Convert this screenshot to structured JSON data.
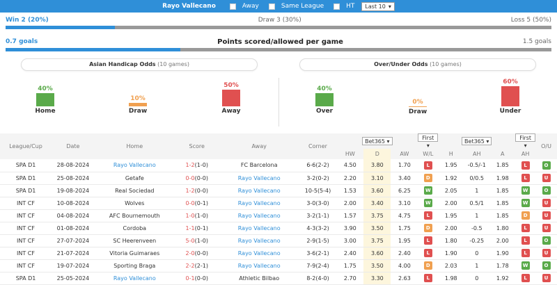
{
  "filter": {
    "team": "Rayo Vallecano",
    "away_label": "Away",
    "same_league_label": "Same League",
    "ht_label": "HT",
    "last_select": "Last 10"
  },
  "record": {
    "win": "Win 2 (20%)",
    "draw": "Draw 3 (30%)",
    "loss": "Loss 5 (50%)",
    "win_fraction": 0.2
  },
  "goals": {
    "scored": "0.7 goals",
    "title": "Points scored/allowed per game",
    "allowed": "1.5 goals",
    "scored_fraction": 0.32
  },
  "asian": {
    "title": "Asian Handicap Odds",
    "sub": "(10 games)",
    "cols": [
      {
        "label": "Home",
        "pct": "40%",
        "value": 40,
        "color": "#5aaa4a"
      },
      {
        "label": "Draw",
        "pct": "10%",
        "value": 10,
        "color": "#f0a050"
      },
      {
        "label": "Away",
        "pct": "50%",
        "value": 50,
        "color": "#e05050"
      }
    ]
  },
  "overunder": {
    "title": "Over/Under Odds",
    "sub": "(10 games)",
    "cols": [
      {
        "label": "Over",
        "pct": "40%",
        "value": 40,
        "color": "#5aaa4a"
      },
      {
        "label": "Draw",
        "pct": "0%",
        "value": 0,
        "color": "#f0a050"
      },
      {
        "label": "Under",
        "pct": "60%",
        "value": 60,
        "color": "#e05050"
      }
    ]
  },
  "table": {
    "headers": [
      "League/Cup",
      "Date",
      "Home",
      "Score",
      "Away",
      "Corner"
    ],
    "ou_header": "O/U",
    "bookmaker1": "Bet365",
    "bookmaker2": "Bet365",
    "first1": "First",
    "first2": "First",
    "sub_headers": [
      "HW",
      "D",
      "AW",
      "W/L",
      "H",
      "AH",
      "A",
      "AH"
    ],
    "rows": [
      {
        "league": "SPA D1",
        "date": "28-08-2024",
        "home": "Rayo Vallecano",
        "home_hl": true,
        "score": "1-2(1-0)",
        "away": "FC Barcelona",
        "away_hl": false,
        "corner": "6-6(2-2)",
        "hw": "4.50",
        "d": "3.80",
        "aw": "1.70",
        "wl": "L",
        "h": "1.95",
        "ah": "-0.5/-1",
        "a": "1.85",
        "ah2": "L",
        "ou": "O"
      },
      {
        "league": "SPA D1",
        "date": "25-08-2024",
        "home": "Getafe",
        "home_hl": false,
        "score": "0-0(0-0)",
        "away": "Rayo Vallecano",
        "away_hl": true,
        "corner": "3-2(0-2)",
        "hw": "2.20",
        "d": "3.10",
        "aw": "3.40",
        "wl": "D",
        "h": "1.92",
        "ah": "0/0.5",
        "a": "1.98",
        "ah2": "L",
        "ou": "U"
      },
      {
        "league": "SPA D1",
        "date": "19-08-2024",
        "home": "Real Sociedad",
        "home_hl": false,
        "score": "1-2(0-0)",
        "away": "Rayo Vallecano",
        "away_hl": true,
        "corner": "10-5(5-4)",
        "hw": "1.53",
        "d": "3.60",
        "aw": "6.25",
        "wl": "W",
        "h": "2.05",
        "ah": "1",
        "a": "1.85",
        "ah2": "W",
        "ou": "O"
      },
      {
        "league": "INT CF",
        "date": "10-08-2024",
        "home": "Wolves",
        "home_hl": false,
        "score": "0-0(0-1)",
        "away": "Rayo Vallecano",
        "away_hl": true,
        "corner": "3-0(3-0)",
        "hw": "2.00",
        "d": "3.40",
        "aw": "3.10",
        "wl": "W",
        "h": "2.00",
        "ah": "0.5/1",
        "a": "1.85",
        "ah2": "W",
        "ou": "U"
      },
      {
        "league": "INT CF",
        "date": "04-08-2024",
        "home": "AFC Bournemouth",
        "home_hl": false,
        "score": "1-0(1-0)",
        "away": "Rayo Vallecano",
        "away_hl": true,
        "corner": "3-2(1-1)",
        "hw": "1.57",
        "d": "3.75",
        "aw": "4.75",
        "wl": "L",
        "h": "1.95",
        "ah": "1",
        "a": "1.85",
        "ah2": "D",
        "ou": "U"
      },
      {
        "league": "INT CF",
        "date": "01-08-2024",
        "home": "Cordoba",
        "home_hl": false,
        "score": "1-1(0-1)",
        "away": "Rayo Vallecano",
        "away_hl": true,
        "corner": "4-3(3-2)",
        "hw": "3.90",
        "d": "3.50",
        "aw": "1.75",
        "wl": "D",
        "h": "2.00",
        "ah": "-0.5",
        "a": "1.80",
        "ah2": "L",
        "ou": "U"
      },
      {
        "league": "INT CF",
        "date": "27-07-2024",
        "home": "SC Heerenveen",
        "home_hl": false,
        "score": "5-0(1-0)",
        "away": "Rayo Vallecano",
        "away_hl": true,
        "corner": "2-9(1-5)",
        "hw": "3.00",
        "d": "3.75",
        "aw": "1.95",
        "wl": "L",
        "h": "1.80",
        "ah": "-0.25",
        "a": "2.00",
        "ah2": "L",
        "ou": "O"
      },
      {
        "league": "INT CF",
        "date": "21-07-2024",
        "home": "Vitoria Guimaraes",
        "home_hl": false,
        "score": "2-0(0-0)",
        "away": "Rayo Vallecano",
        "away_hl": true,
        "corner": "3-6(2-1)",
        "hw": "2.40",
        "d": "3.60",
        "aw": "2.40",
        "wl": "L",
        "h": "1.90",
        "ah": "0",
        "a": "1.90",
        "ah2": "L",
        "ou": "U"
      },
      {
        "league": "INT CF",
        "date": "19-07-2024",
        "home": "Sporting Braga",
        "home_hl": false,
        "score": "2-2(2-1)",
        "away": "Rayo Vallecano",
        "away_hl": true,
        "corner": "7-9(2-4)",
        "hw": "1.75",
        "d": "3.50",
        "aw": "4.00",
        "wl": "D",
        "h": "2.03",
        "ah": "1",
        "a": "1.78",
        "ah2": "W",
        "ou": "O"
      },
      {
        "league": "SPA D1",
        "date": "25-05-2024",
        "home": "Rayo Vallecano",
        "home_hl": true,
        "score": "0-1(0-0)",
        "away": "Athletic Bilbao",
        "away_hl": false,
        "corner": "8-2(4-0)",
        "hw": "2.70",
        "d": "3.30",
        "aw": "2.63",
        "wl": "L",
        "h": "1.98",
        "ah": "0",
        "a": "1.92",
        "ah2": "L",
        "ou": "U"
      }
    ]
  }
}
